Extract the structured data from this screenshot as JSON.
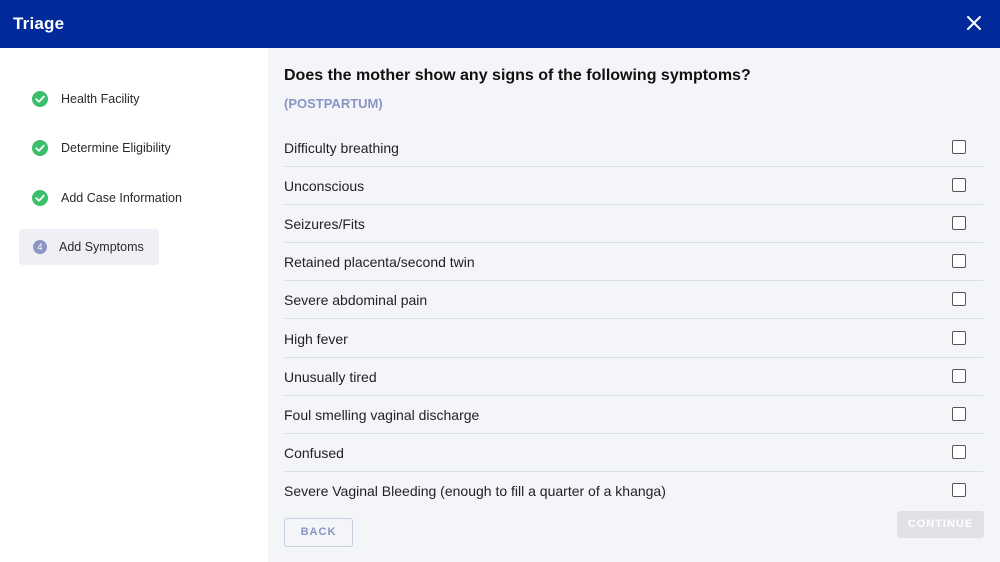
{
  "header": {
    "title": "Triage",
    "close_icon": "close-icon"
  },
  "colors": {
    "header_bg": "#022a9a",
    "completed_green": "#3bbf6a",
    "step_active_bg": "#eef0f6",
    "accent_muted": "#8a94c4"
  },
  "sidebar": {
    "steps": [
      {
        "label": "Health Facility",
        "status": "completed",
        "icon": "check-circle-icon"
      },
      {
        "label": "Determine Eligibility",
        "status": "completed",
        "icon": "check-circle-icon"
      },
      {
        "label": "Add Case Information",
        "status": "completed",
        "icon": "check-circle-icon"
      },
      {
        "label": "Add Symptoms",
        "status": "active",
        "number": "4"
      }
    ]
  },
  "main": {
    "question": "Does the mother show any signs of the following symptoms?",
    "subtitle": "(POSTPARTUM)",
    "symptoms": [
      {
        "label": "Difficulty breathing",
        "checked": false
      },
      {
        "label": "Unconscious",
        "checked": false
      },
      {
        "label": "Seizures/Fits",
        "checked": false
      },
      {
        "label": "Retained placenta/second twin",
        "checked": false
      },
      {
        "label": "Severe abdominal pain",
        "checked": false
      },
      {
        "label": "High fever",
        "checked": false
      },
      {
        "label": "Unusually tired",
        "checked": false
      },
      {
        "label": "Foul smelling vaginal discharge",
        "checked": false
      },
      {
        "label": "Confused",
        "checked": false
      },
      {
        "label": "Severe Vaginal Bleeding (enough to fill a quarter of a khanga)",
        "checked": false
      }
    ],
    "back_label": "BACK",
    "continue_label": "CONTINUE"
  }
}
